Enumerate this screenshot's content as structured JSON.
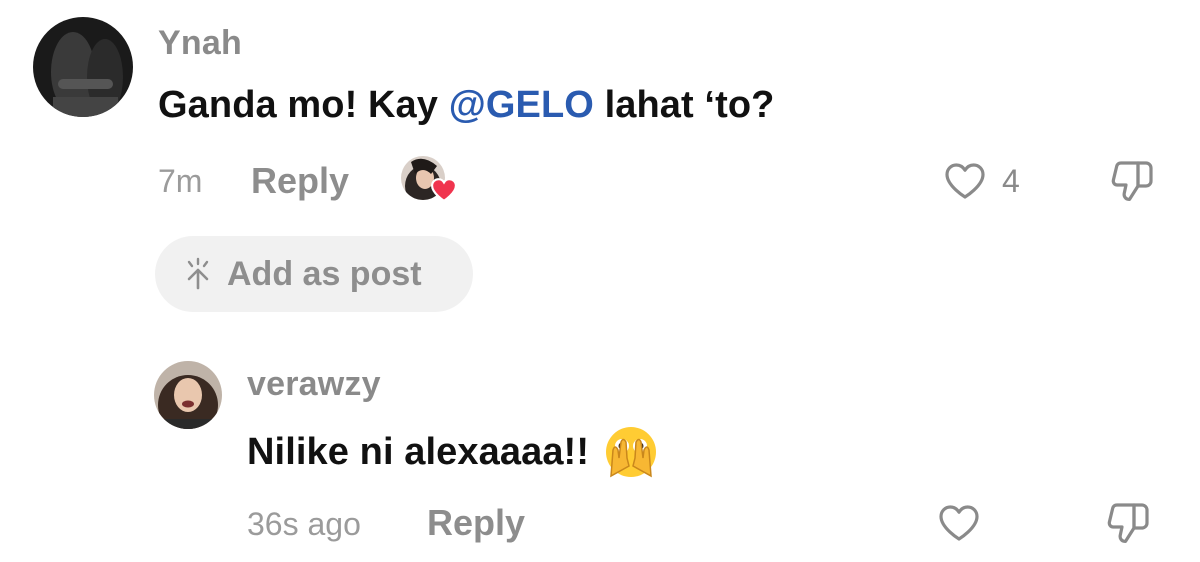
{
  "comments": [
    {
      "username": "Ynah",
      "text_before": "Ganda mo! Kay ",
      "mention": "@GELO",
      "text_after": " lahat ‘to?",
      "time": "7m",
      "reply_label": "Reply",
      "like_count": "4",
      "add_as_post_label": "Add as post",
      "creator_liked": true
    },
    {
      "username": "verawzy",
      "text": "Nilike ni alexaaaa!!",
      "emoji": "face-with-open-eyes-and-hand-over-mouth",
      "time": "36s ago",
      "reply_label": "Reply"
    }
  ],
  "colors": {
    "mention": "#2a5bb0",
    "heart_badge": "#f0344e",
    "muted_text": "#8a8a8a"
  },
  "icons": [
    "heart-outline-icon",
    "thumbs-down-icon",
    "add-post-icon",
    "creator-liked-badge-icon"
  ]
}
